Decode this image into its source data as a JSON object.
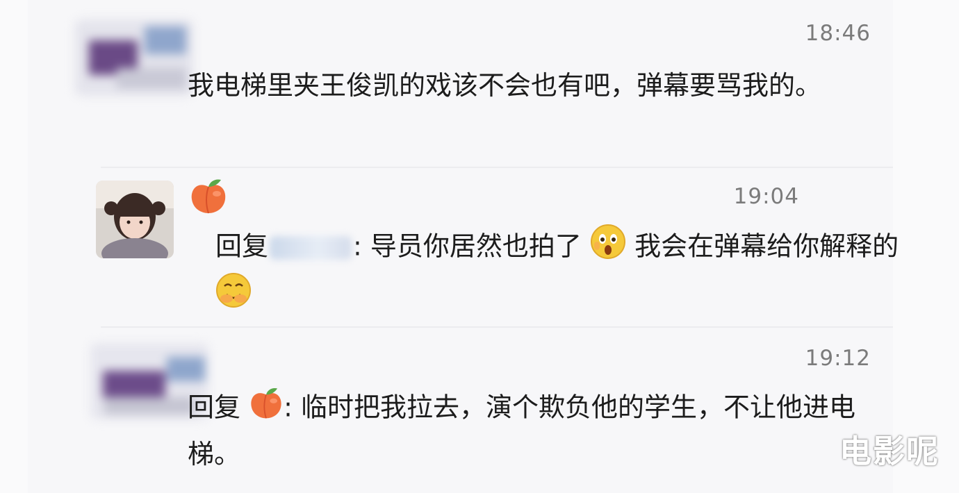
{
  "messages": [
    {
      "time": "18:46",
      "text": "我电梯里夹王俊凯的戏该不会也有吧，弹幕要骂我的。"
    },
    {
      "time": "19:04",
      "reply_prefix": "回复",
      "reply_suffix": ": 导员你居然也拍了",
      "text_after": "我会在弹幕给你解释的",
      "author_icon": "peach-icon"
    },
    {
      "time": "19:12",
      "reply_prefix": "回复",
      "reply_suffix": ": 临时把我拉去，演个欺负他的学生，不让他进电梯。",
      "author_icon": "peach-icon"
    }
  ],
  "watermark": "电影呢"
}
